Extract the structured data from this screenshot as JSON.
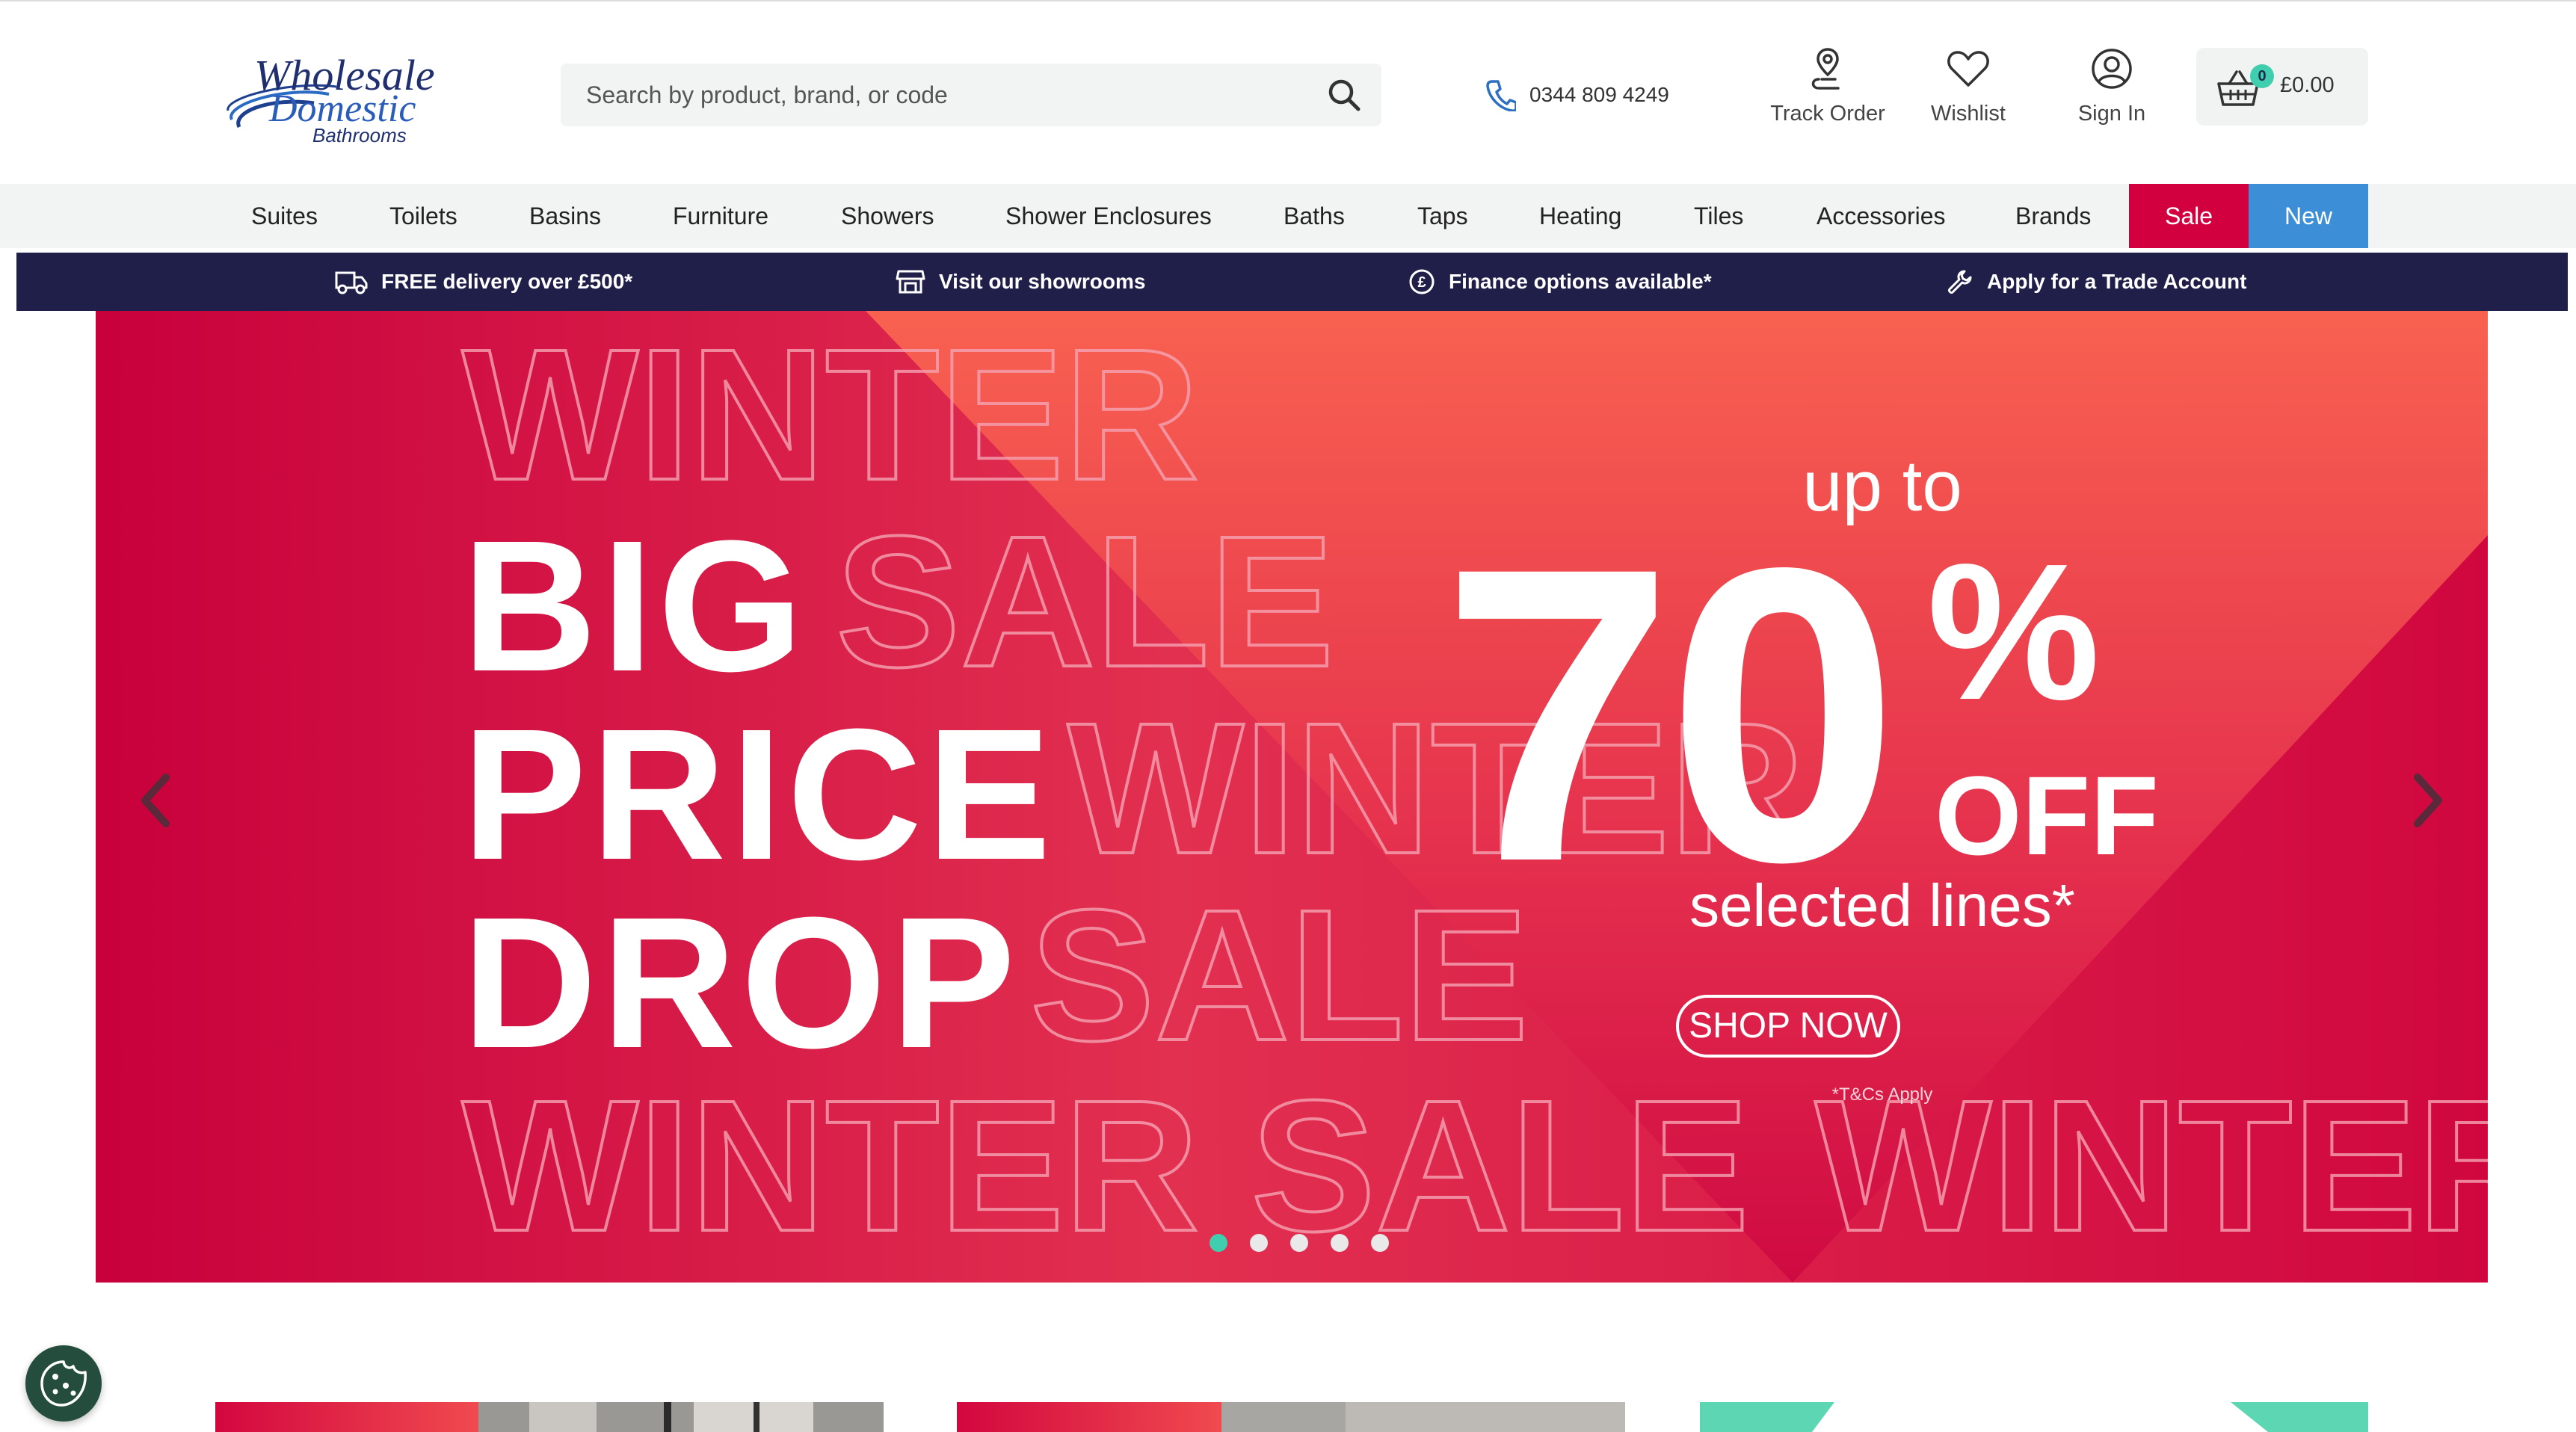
{
  "header": {
    "logo": {
      "line1": "Wholesale",
      "line2": "Domestic",
      "line3": "Bathrooms"
    },
    "search": {
      "placeholder": "Search by product, brand, or code",
      "icon": "search-icon"
    },
    "phone": {
      "number": "0344 809 4249",
      "icon": "phone-icon"
    },
    "track_order": {
      "label": "Track Order",
      "icon": "location-pin-icon"
    },
    "wishlist": {
      "label": "Wishlist",
      "icon": "heart-icon"
    },
    "sign_in": {
      "label": "Sign In",
      "icon": "user-icon"
    },
    "basket": {
      "count": "0",
      "total": "£0.00",
      "icon": "basket-icon"
    }
  },
  "nav": {
    "items": [
      "Suites",
      "Toilets",
      "Basins",
      "Furniture",
      "Showers",
      "Shower Enclosures",
      "Baths",
      "Taps",
      "Heating",
      "Tiles",
      "Accessories",
      "Brands"
    ],
    "sale": "Sale",
    "new": "New",
    "colors": {
      "sale": "#d2003f",
      "new": "#3c8fd6"
    }
  },
  "usp": [
    {
      "text": "FREE delivery over £500*",
      "icon": "delivery-truck-icon"
    },
    {
      "text": "Visit our showrooms",
      "icon": "store-icon"
    },
    {
      "text": "Finance options available*",
      "icon": "pound-icon"
    },
    {
      "text": "Apply for a Trade Account",
      "icon": "wrench-icon"
    }
  ],
  "hero": {
    "headline": [
      "BIG",
      "PRICE",
      "DROP"
    ],
    "outline_words": [
      "WINTER",
      "SALE",
      "WINTER",
      "SALE",
      "WINTER SALE",
      "WINTER"
    ],
    "up_to": "up to",
    "percent": "70",
    "percent_sign": "%",
    "off": "OFF",
    "selected": "selected lines*",
    "cta": "SHOP NOW",
    "terms": "*T&Cs Apply",
    "slide_count": 5,
    "active_slide": 1,
    "colors": {
      "primary": "#d3073f",
      "accent": "#f6574f"
    }
  },
  "cookie": {
    "icon": "cookie-icon"
  }
}
